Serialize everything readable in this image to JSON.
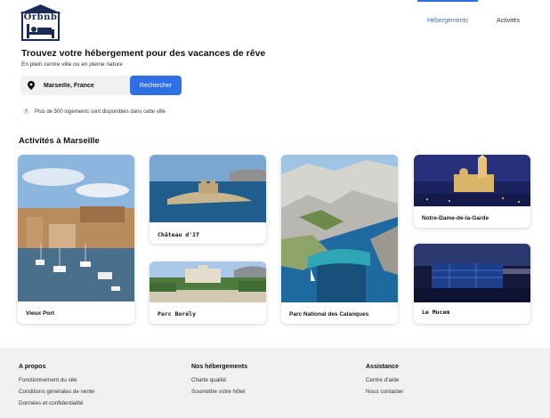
{
  "header": {
    "logo_text": "Orbnb",
    "nav": [
      {
        "label": "Hébergements",
        "active": true
      },
      {
        "label": "Activités",
        "active": false
      }
    ]
  },
  "hero": {
    "title": "Trouvez votre hébergement pour des vacances de rêve",
    "subtitle": "En plein centre ville ou en pleine nature",
    "search": {
      "value": "Marseille, France",
      "button_label": "Rechercher",
      "icon": "map-pin-icon"
    },
    "info_text": "Plus de 500 logements sont disponibles dans cette ville",
    "info_icon": "info-icon"
  },
  "activities": {
    "title": "Activités à Marseille",
    "cards": [
      {
        "label": "Vieux Port"
      },
      {
        "label": "Château d'If"
      },
      {
        "label": "Parc Borély"
      },
      {
        "label": "Parc National des Calanques"
      },
      {
        "label": "Notre-Dame-de-la-Garde"
      },
      {
        "label": "Le Mucem"
      }
    ]
  },
  "footer": {
    "columns": [
      {
        "title": "A propos",
        "links": [
          "Fonctionnement du site",
          "Conditions générales de vente",
          "Données et confidentialité"
        ]
      },
      {
        "title": "Nos hébergements",
        "links": [
          "Charte qualité",
          "Soumettre votre hôtel"
        ]
      },
      {
        "title": "Assistance",
        "links": [
          "Centre d'aide",
          "Nous contacter"
        ]
      }
    ]
  },
  "colors": {
    "accent": "#2f6fe4",
    "brand": "#1c2a5a",
    "footer_bg": "#f0f0f0"
  }
}
